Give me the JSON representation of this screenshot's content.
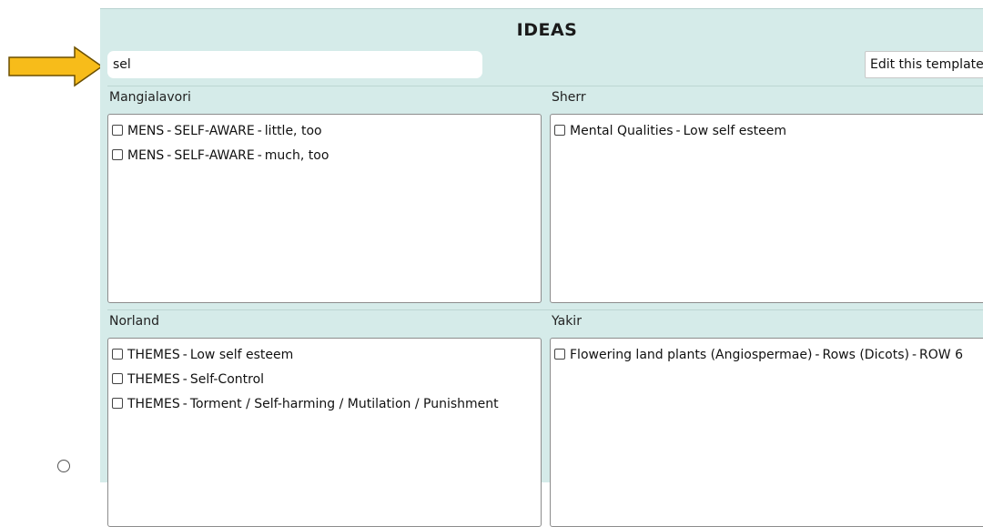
{
  "panel": {
    "title": "IDEAS",
    "search_value": "sel",
    "edit_button_label": "Edit this template"
  },
  "sections": [
    {
      "label": "Mangialavori",
      "items": [
        {
          "category": "MENS",
          "subcategory": "SELF-AWARE",
          "detail": "little, too"
        },
        {
          "category": "MENS",
          "subcategory": "SELF-AWARE",
          "detail": "much, too"
        }
      ]
    },
    {
      "label": "Sherr",
      "items": [
        {
          "category": "Mental Qualities",
          "detail": "Low self esteem"
        }
      ]
    },
    {
      "label": "Norland",
      "items": [
        {
          "category": "THEMES",
          "detail": "Low self esteem"
        },
        {
          "category": "THEMES",
          "detail": "Self-Control"
        },
        {
          "category": "THEMES",
          "detail": "Torment / Self-harming / Mutilation / Punishment"
        }
      ]
    },
    {
      "label": "Yakir",
      "items": [
        {
          "category": "Flowering land plants (Angiospermae)",
          "subcategory": "Rows (Dicots)",
          "detail": "ROW 6"
        }
      ]
    }
  ],
  "colors": {
    "panel_bg": "#d5ebe9",
    "arrow_fill": "#f7bc1a"
  }
}
